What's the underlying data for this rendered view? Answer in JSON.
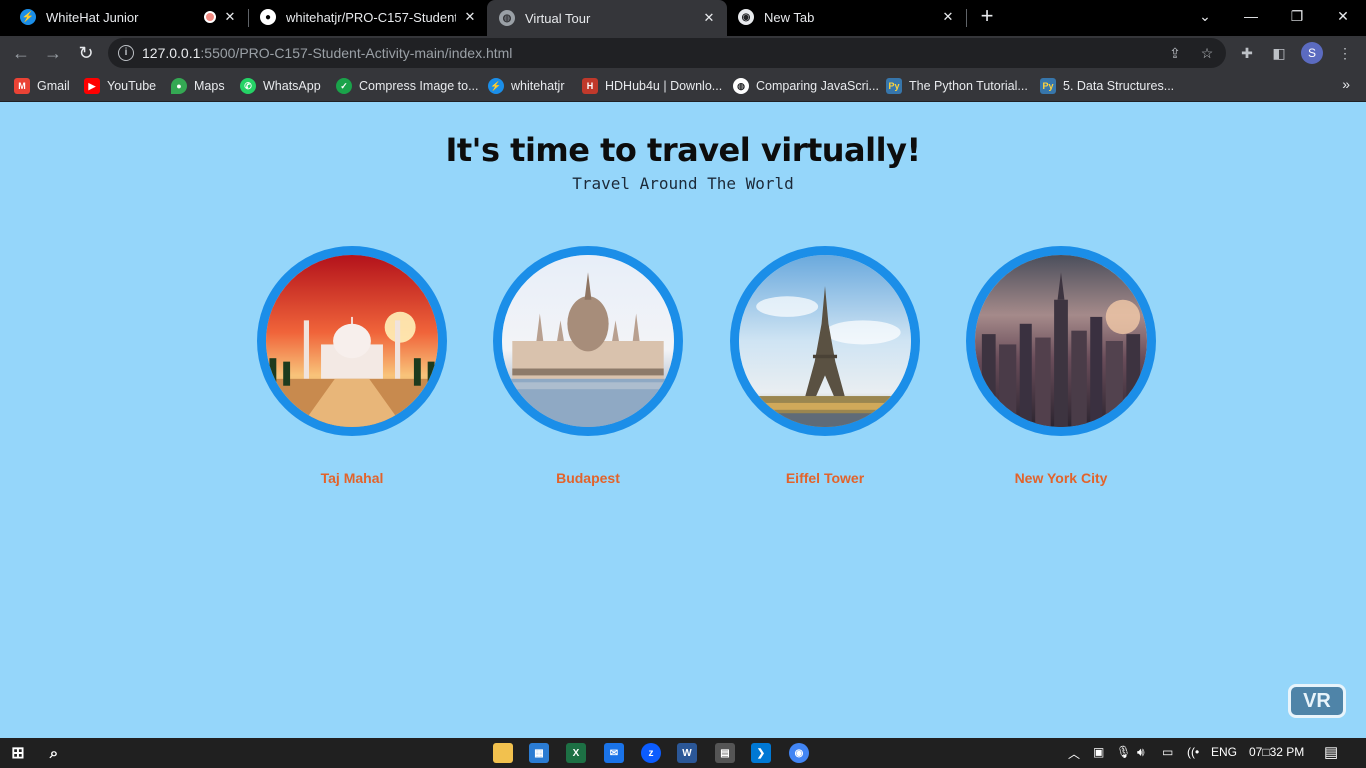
{
  "browser": {
    "tabs": [
      {
        "title": "WhiteHat Junior",
        "icon": "whitehat-icon",
        "active": false,
        "recording": true
      },
      {
        "title": "whitehatjr/PRO-C157-Student-Ac",
        "icon": "github-icon",
        "active": false,
        "recording": false
      },
      {
        "title": "Virtual Tour",
        "icon": "globe-icon",
        "active": true,
        "recording": false
      },
      {
        "title": "New Tab",
        "icon": "chrome-icon",
        "active": false,
        "recording": false
      }
    ],
    "url_host": "127.0.0.1",
    "url_path": ":5500/PRO-C157-Student-Activity-main/index.html",
    "profile_initial": "S"
  },
  "bookmarks": [
    {
      "label": "Gmail",
      "icon": "gmail-icon",
      "color": "#ea4335"
    },
    {
      "label": "YouTube",
      "icon": "youtube-icon",
      "color": "#ff0000"
    },
    {
      "label": "Maps",
      "icon": "maps-icon",
      "color": "#34a853"
    },
    {
      "label": "WhatsApp",
      "icon": "whatsapp-icon",
      "color": "#25d366"
    },
    {
      "label": "Compress Image to...",
      "icon": "check-icon",
      "color": "#1aa34a"
    },
    {
      "label": "whitehatjr",
      "icon": "whitehat-icon",
      "color": "#1b8ee8"
    },
    {
      "label": "HDHub4u | Downlo...",
      "icon": "hdhub-icon",
      "color": "#c0392b"
    },
    {
      "label": "Comparing JavaScri...",
      "icon": "globe-icon",
      "color": "#ffffff"
    },
    {
      "label": "The Python Tutorial...",
      "icon": "python-icon",
      "color": "#3776ab"
    },
    {
      "label": "5. Data Structures...",
      "icon": "python-icon",
      "color": "#3776ab"
    }
  ],
  "page": {
    "heading": "It's time to travel virtually!",
    "subheading": "Travel Around The World",
    "places": [
      {
        "name": "Taj Mahal"
      },
      {
        "name": "Budapest"
      },
      {
        "name": "Eiffel Tower"
      },
      {
        "name": "New York City"
      }
    ],
    "vr_label": "VR"
  },
  "taskbar": {
    "language": "ENG",
    "time": "07□32 PM"
  },
  "colors": {
    "page_bg": "#95d6fa",
    "ring": "#1b8ee8",
    "label": "#e2632b",
    "vr_btn": "#4f84a8"
  }
}
